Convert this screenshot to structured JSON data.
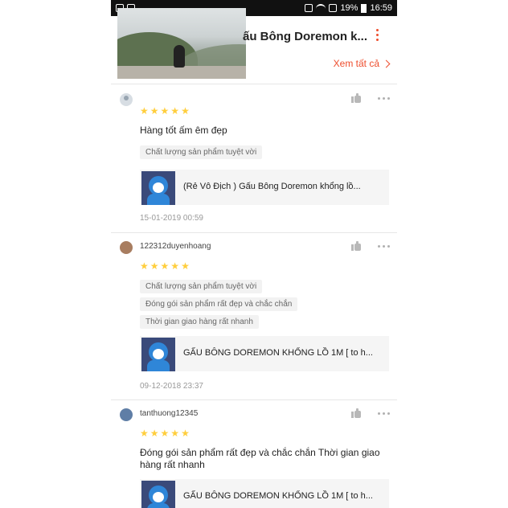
{
  "status_bar": {
    "battery": "19%",
    "time": "16:59"
  },
  "header": {
    "title": "ấu Bông Doremon k...",
    "see_all": "Xem tất cả"
  },
  "reviews": [
    {
      "username": "",
      "rating": 5,
      "content": "Hàng tốt ấm êm đẹp",
      "tags": [
        "Chất lượng sản phẩm tuyệt vời"
      ],
      "product_name": "(Rẻ Vô  Địch ) Gấu Bông Doremon khổng lồ...",
      "date": "15-01-2019 00:59"
    },
    {
      "username": "122312duyenhoang",
      "rating": 5,
      "content": "",
      "tags": [
        "Chất lượng sản phẩm tuyệt vời",
        "Đóng gói sản phẩm rất đẹp và chắc chắn",
        "Thời gian giao hàng rất nhanh"
      ],
      "product_name": "GẤU BÔNG DOREMON KHỔNG LỒ 1M [ to h...",
      "date": "09-12-2018 23:37"
    },
    {
      "username": "tanthuong12345",
      "rating": 5,
      "content": "Đóng gói sản phẩm rất đẹp và chắc chắn Thời gian giao hàng rất nhanh",
      "tags": [],
      "product_name": "GẤU BÔNG DOREMON KHỔNG LỒ 1M [ to h...",
      "date": ""
    }
  ],
  "colors": {
    "accent": "#ee4d2d",
    "star": "#ffce3d"
  }
}
